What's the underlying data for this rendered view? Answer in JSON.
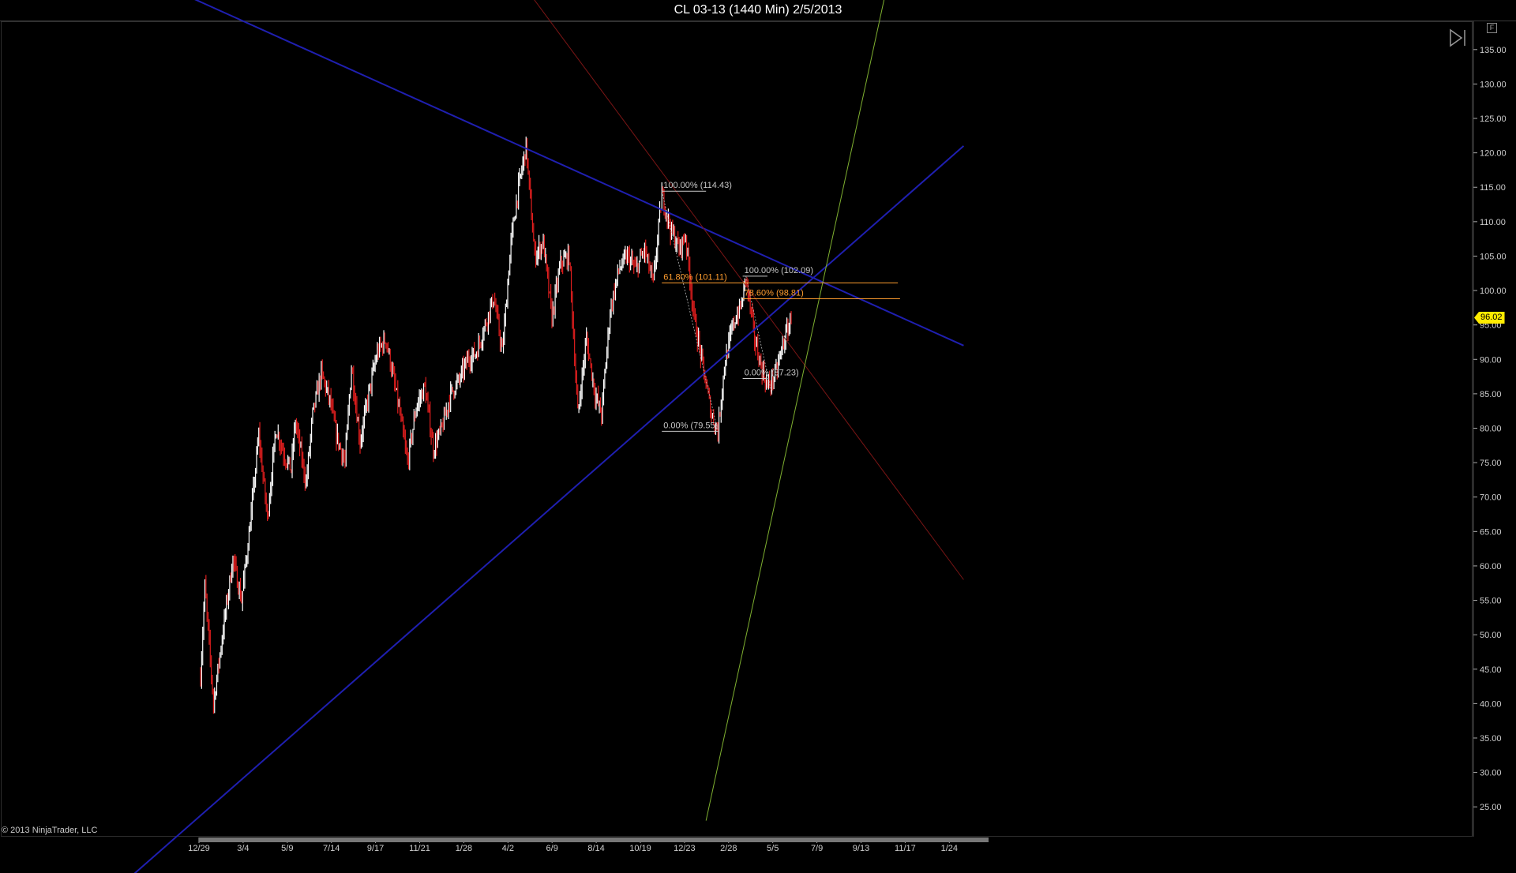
{
  "window": {
    "title": "CL 03-13 (1440 Min)  2/5/2013",
    "copyright": "© 2013 NinjaTrader, LLC",
    "panel_button": "F"
  },
  "last_price": "96.02",
  "colors": {
    "background": "#000000",
    "axis": "#cccccc",
    "up_bar": "#ffffff",
    "down_bar": "#e01e1e",
    "trendline_blue": "#1f1fb0",
    "trendline_red": "#7a1515",
    "trendline_green": "#7fb030",
    "fib_retracement": "#ff9d2e",
    "fib_neutral": "#c8c8c8",
    "price_marker": "#ffeb00"
  },
  "chart_data": {
    "type": "candlestick",
    "title": "CL 03-13 (1440 Min)  2/5/2013",
    "ylim": [
      22.5,
      137.5
    ],
    "y_ticks": [
      "25.00",
      "30.00",
      "35.00",
      "40.00",
      "45.00",
      "50.00",
      "55.00",
      "60.00",
      "65.00",
      "70.00",
      "75.00",
      "80.00",
      "85.00",
      "90.00",
      "95.00",
      "100.00",
      "105.00",
      "110.00",
      "115.00",
      "120.00",
      "125.00",
      "130.00",
      "135.00"
    ],
    "x_labels": [
      "12/29",
      "3/4",
      "5/9",
      "7/14",
      "9/17",
      "11/21",
      "1/28",
      "4/2",
      "6/9",
      "8/14",
      "10/19",
      "12/23",
      "2/28",
      "5/5",
      "7/9",
      "9/13",
      "11/17",
      "1/24"
    ],
    "grid": false,
    "price_anchors": [
      [
        0,
        44
      ],
      [
        4,
        57
      ],
      [
        12,
        40
      ],
      [
        22,
        52
      ],
      [
        30,
        61
      ],
      [
        38,
        55
      ],
      [
        46,
        66
      ],
      [
        54,
        79
      ],
      [
        62,
        67
      ],
      [
        70,
        80
      ],
      [
        78,
        76
      ],
      [
        84,
        74
      ],
      [
        88,
        81
      ],
      [
        98,
        72
      ],
      [
        104,
        82
      ],
      [
        112,
        88
      ],
      [
        120,
        84
      ],
      [
        126,
        79
      ],
      [
        134,
        75
      ],
      [
        140,
        89
      ],
      [
        148,
        78
      ],
      [
        156,
        85
      ],
      [
        164,
        91
      ],
      [
        172,
        93
      ],
      [
        178,
        88
      ],
      [
        184,
        83
      ],
      [
        192,
        75
      ],
      [
        200,
        83
      ],
      [
        208,
        86
      ],
      [
        216,
        77
      ],
      [
        224,
        80
      ],
      [
        232,
        85
      ],
      [
        240,
        87
      ],
      [
        248,
        90
      ],
      [
        256,
        91
      ],
      [
        264,
        95
      ],
      [
        272,
        99
      ],
      [
        280,
        91
      ],
      [
        288,
        107
      ],
      [
        294,
        114
      ],
      [
        302,
        121
      ],
      [
        310,
        105
      ],
      [
        318,
        107
      ],
      [
        326,
        96
      ],
      [
        334,
        104
      ],
      [
        342,
        105
      ],
      [
        350,
        82
      ],
      [
        358,
        93
      ],
      [
        366,
        85
      ],
      [
        372,
        82
      ],
      [
        380,
        97
      ],
      [
        388,
        103
      ],
      [
        396,
        105
      ],
      [
        404,
        103
      ],
      [
        412,
        106
      ],
      [
        420,
        101
      ],
      [
        428,
        114
      ],
      [
        436,
        109
      ],
      [
        444,
        106
      ],
      [
        450,
        108
      ],
      [
        458,
        96
      ],
      [
        466,
        89
      ],
      [
        474,
        82
      ],
      [
        480,
        79.55
      ],
      [
        486,
        89
      ],
      [
        494,
        95
      ],
      [
        502,
        98
      ],
      [
        506,
        102.09
      ],
      [
        514,
        93
      ],
      [
        520,
        89
      ],
      [
        526,
        86
      ],
      [
        534,
        88
      ],
      [
        540,
        92
      ],
      [
        548,
        96
      ]
    ],
    "bar_count": 549,
    "volatility": 1.4,
    "trendlines": [
      {
        "name": "upper-resistance",
        "color": "blue",
        "from": [
          -72,
          147
        ],
        "to": [
          708,
          92
        ]
      },
      {
        "name": "lower-support",
        "color": "blue",
        "from": [
          -100,
          10
        ],
        "to": [
          708,
          121
        ]
      },
      {
        "name": "red-channel",
        "color": "red",
        "from": [
          254,
          154
        ],
        "to": [
          708,
          58
        ]
      },
      {
        "name": "green-trend",
        "color": "green",
        "from": [
          469,
          23
        ],
        "to": [
          656,
          158
        ]
      }
    ],
    "fibonacci": [
      {
        "label": "100.00% (114.43)",
        "value": 114.43,
        "x_start": 428,
        "x_end": 469,
        "color": "neutral"
      },
      {
        "label": "61.80% (101.11)",
        "value": 101.11,
        "x_start": 428,
        "x_end": 647,
        "color": "fib"
      },
      {
        "label": "0.00% (79.55)",
        "value": 79.55,
        "x_start": 428,
        "x_end": 480,
        "color": "neutral"
      },
      {
        "label": "100.00% (102.09)",
        "value": 102.09,
        "x_start": 503,
        "x_end": 526,
        "color": "neutral"
      },
      {
        "label": "78.60% (98.81)",
        "value": 98.81,
        "x_start": 503,
        "x_end": 649,
        "color": "fib"
      },
      {
        "label": "0.00% (87.23)",
        "value": 87.23,
        "x_start": 503,
        "x_end": 526,
        "color": "neutral"
      }
    ],
    "fib_swings": [
      {
        "from": [
          428,
          114.43
        ],
        "to": [
          480,
          79.55
        ]
      },
      {
        "from": [
          506,
          102.09
        ],
        "to": [
          530,
          85.0
        ]
      }
    ]
  }
}
